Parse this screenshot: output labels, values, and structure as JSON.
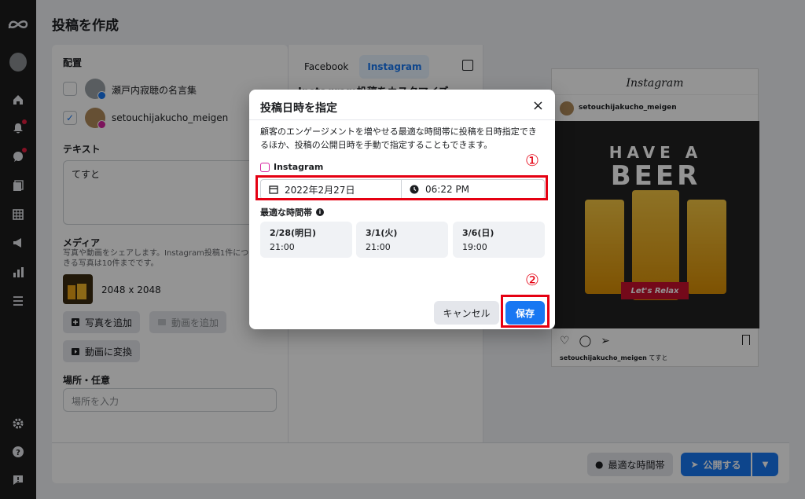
{
  "page": {
    "title": "投稿を作成"
  },
  "left": {
    "placement_label": "配置",
    "accounts": [
      {
        "name": "瀬戸内寂聴の名言集",
        "checked": false,
        "network": "facebook"
      },
      {
        "name": "setouchijakucho_meigen",
        "checked": true,
        "network": "instagram"
      }
    ],
    "text_label": "テキスト",
    "text_value": "てすと",
    "hash_icon": "#",
    "media_label": "メディア",
    "media_help": "写真や動画をシェアします。Instagram投稿1件につき\nきる写真は10件までです。",
    "media_size": "2048 x 2048",
    "add_photo": "写真を追加",
    "add_video": "動画を追加",
    "convert_video": "動画に変換",
    "location_label": "場所・任意",
    "location_placeholder": "場所を入力"
  },
  "middle": {
    "tabs": [
      "Facebook",
      "Instagram"
    ],
    "active_tab": "Instagram",
    "customize_heading": "Instagram投稿をカスタマイズ"
  },
  "preview": {
    "logo": "Instagram",
    "username": "setouchijakucho_meigen",
    "image_headline_1": "HAVE A",
    "image_headline_2": "BEER",
    "image_banner": "Let's Relax",
    "caption_user": "setouchijakucho_meigen",
    "caption_text": "てすと"
  },
  "footer": {
    "best_time": "最適な時間帯",
    "publish": "公開する"
  },
  "modal": {
    "title": "投稿日時を指定",
    "close": "×",
    "description": "顧客のエンゲージメントを増やせる最適な時間帯に投稿を日時指定できるほか、投稿の公開日時を手動で指定することもできます。",
    "platform": "Instagram",
    "date": "2022年2月27日",
    "time": "06:22 PM",
    "best_times_label": "最適な時間帯",
    "slots": [
      {
        "day": "2/28(明日)",
        "time": "21:00"
      },
      {
        "day": "3/1(火)",
        "time": "21:00"
      },
      {
        "day": "3/6(日)",
        "time": "19:00"
      }
    ],
    "cancel": "キャンセル",
    "save": "保存"
  },
  "annotations": {
    "marker_1": "①",
    "marker_2": "②",
    "color": "#e50012"
  },
  "colors": {
    "accent": "#1877f2",
    "rail": "#1c1c1c"
  }
}
